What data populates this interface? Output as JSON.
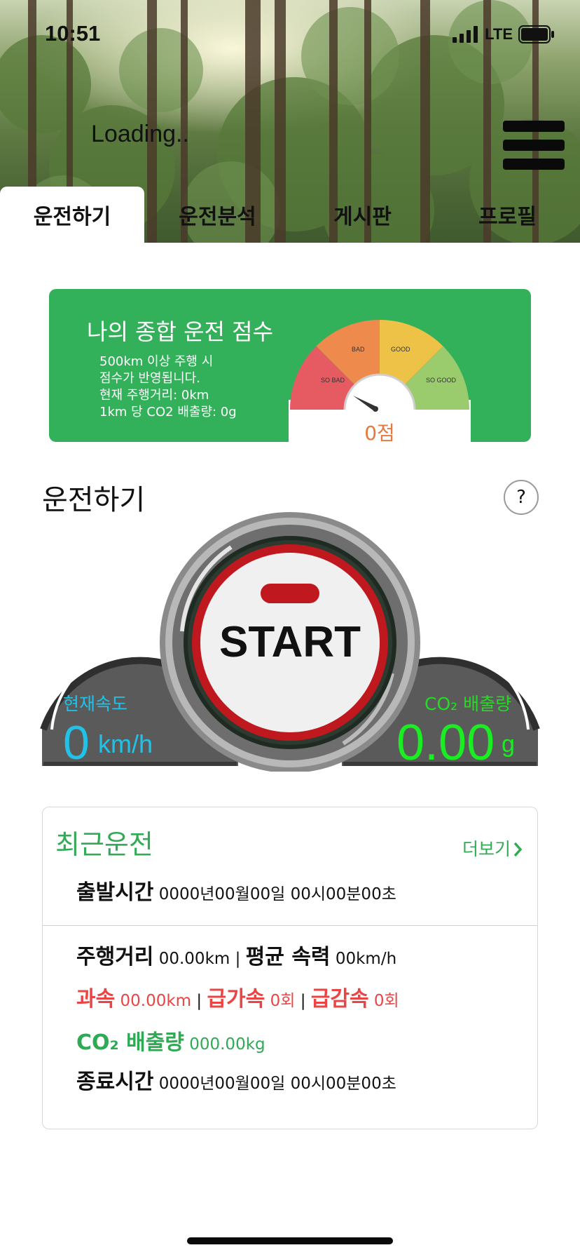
{
  "status_bar": {
    "time": "10:51",
    "network": "LTE"
  },
  "header": {
    "loading_text": "Loading.."
  },
  "tabs": [
    {
      "label": "운전하기",
      "active": true
    },
    {
      "label": "운전분석",
      "active": false
    },
    {
      "label": "게시판",
      "active": false
    },
    {
      "label": "프로필",
      "active": false
    }
  ],
  "score_card": {
    "title": "나의 종합 운전 점수",
    "desc_line1": "500km 이상 주행 시",
    "desc_line2": "점수가 반영됩니다.",
    "desc_line3": "현재 주행거리: 0km",
    "desc_line4": "1km 당 CO2 배출량: 0g",
    "gauge_labels": {
      "so_bad": "SO BAD",
      "bad": "BAD",
      "good": "GOOD",
      "so_good": "SO GOOD"
    },
    "score_text": "0점"
  },
  "drive": {
    "title": "운전하기",
    "help": "?",
    "start_label": "START",
    "speed_label": "현재속도",
    "speed_value": "0",
    "speed_unit": "km/h",
    "co2_label": "CO₂ 배출량",
    "co2_value": "0.00",
    "co2_unit": "g"
  },
  "recent": {
    "title": "최근운전",
    "more": "더보기",
    "start_time_label": "출발시간",
    "start_time_value": "0000년00월00일 00시00분00초",
    "distance_label": "주행거리",
    "distance_value": "00.00km",
    "avg_speed_label": "평균 속력",
    "avg_speed_value": "00km/h",
    "speeding_label": "과속",
    "speeding_value": "00.00km",
    "rapid_accel_label": "급가속",
    "rapid_accel_value": "0회",
    "rapid_decel_label": "급감속",
    "rapid_decel_value": "0회",
    "co2_label": "CO₂ 배출량",
    "co2_value": "000.00kg",
    "end_time_label": "종료시간",
    "end_time_value": "0000년00월00일 00시00분00초",
    "separator": "|"
  },
  "colors": {
    "brand_green": "#33b15a",
    "speed_cyan": "#22c2e8",
    "co2_green": "#1aee22",
    "warning_red": "#e94545",
    "score_orange": "#e6793f"
  },
  "icons": [
    "signal-icon",
    "battery-icon",
    "hamburger-menu-icon",
    "help-icon",
    "chevron-right-icon",
    "gauge-needle-icon"
  ]
}
